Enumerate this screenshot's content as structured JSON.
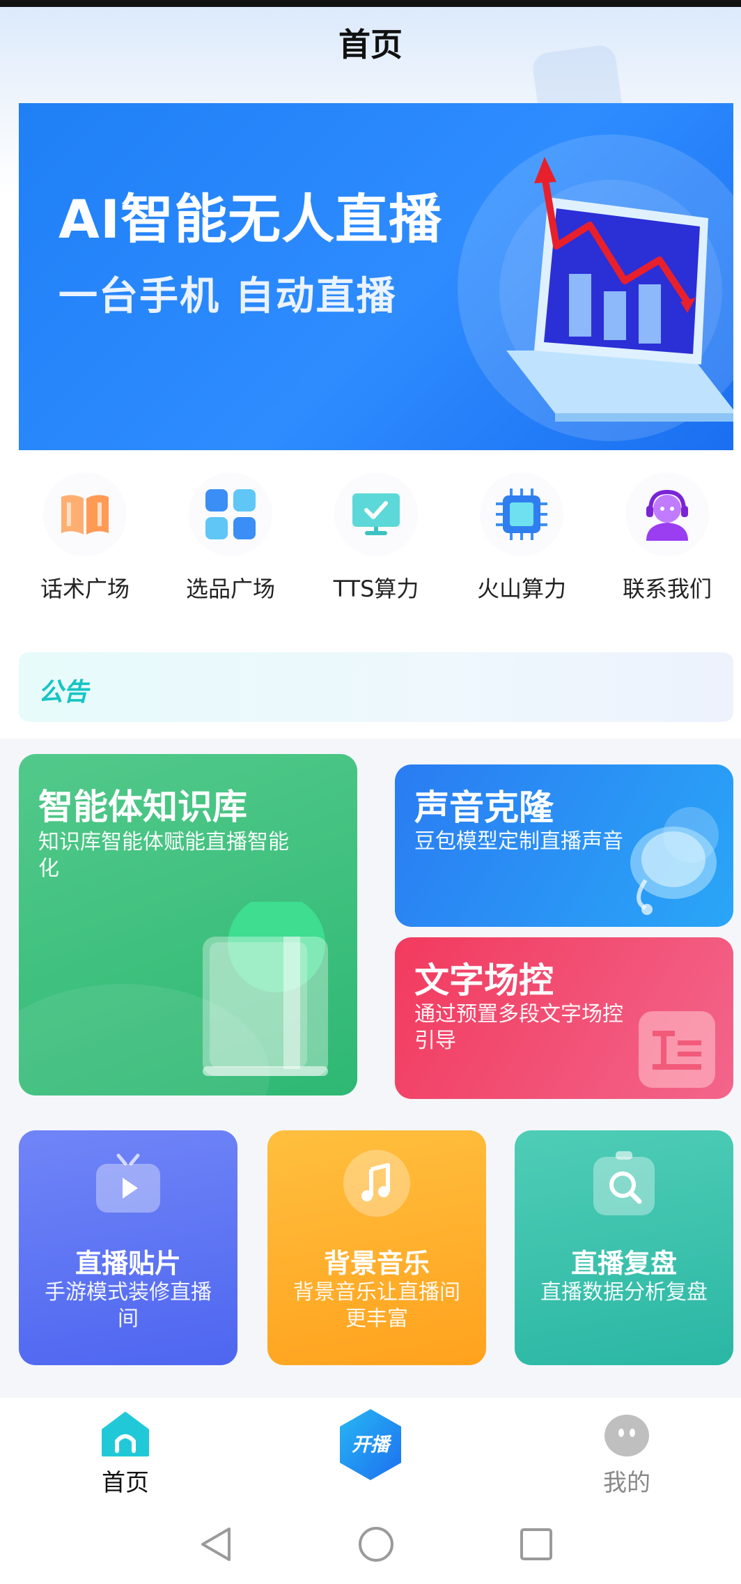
{
  "header": {
    "title": "首页"
  },
  "banner": {
    "title": "AI智能无人直播",
    "subtitle": "一台手机 自动直播"
  },
  "quick_links": [
    {
      "label": "话术广场",
      "icon": "book-icon"
    },
    {
      "label": "选品广场",
      "icon": "grid-icon"
    },
    {
      "label": "TTS算力",
      "icon": "monitor-check-icon"
    },
    {
      "label": "火山算力",
      "icon": "chip-icon"
    },
    {
      "label": "联系我们",
      "icon": "headset-user-icon"
    }
  ],
  "notice": {
    "label": "公告"
  },
  "features": {
    "knowledge": {
      "title": "智能体知识库",
      "desc": "知识库智能体赋能直播智能化"
    },
    "voice": {
      "title": "声音克隆",
      "desc": "豆包模型定制直播声音"
    },
    "text": {
      "title": "文字场控",
      "desc": "通过预置多段文字场控引导"
    }
  },
  "tools": [
    {
      "title": "直播贴片",
      "desc": "手游模式装修直播间",
      "icon": "tv-play-icon"
    },
    {
      "title": "背景音乐",
      "desc": "背景音乐让直播间更丰富",
      "icon": "music-note-icon"
    },
    {
      "title": "直播复盘",
      "desc": "直播数据分析复盘",
      "icon": "search-clipboard-icon"
    }
  ],
  "tabbar": {
    "home": "首页",
    "live": "开播",
    "mine": "我的"
  },
  "colors": {
    "primary": "#1f7ff5",
    "accent_teal": "#16c4c4",
    "tab_active": "#111111",
    "tab_inactive": "#888888"
  }
}
